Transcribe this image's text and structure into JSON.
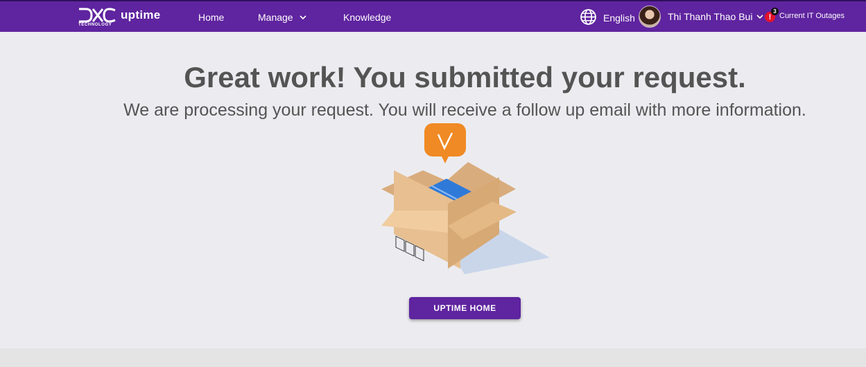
{
  "header": {
    "logo_brand": "DXC",
    "logo_sub": "TECHNOLOGY",
    "app_name": "uptime",
    "nav": {
      "home": "Home",
      "manage": "Manage",
      "knowledge": "Knowledge"
    },
    "language": "English",
    "user_name": "Thi Thanh Thao Bui",
    "outage_count": "3",
    "outage_label": "Current IT Outages"
  },
  "main": {
    "headline": "Great work! You submitted your request.",
    "subline": "We are processing your request. You will receive a follow up email with more information.",
    "cta_label": "UPTIME HOME"
  },
  "colors": {
    "brand_purple": "#5f249f",
    "accent_orange": "#f08a24",
    "package_blue": "#2f7ad9",
    "alert_red": "#e3132c"
  },
  "icons": [
    "globe-icon",
    "chevron-down-icon",
    "alert-icon",
    "check-icon"
  ]
}
